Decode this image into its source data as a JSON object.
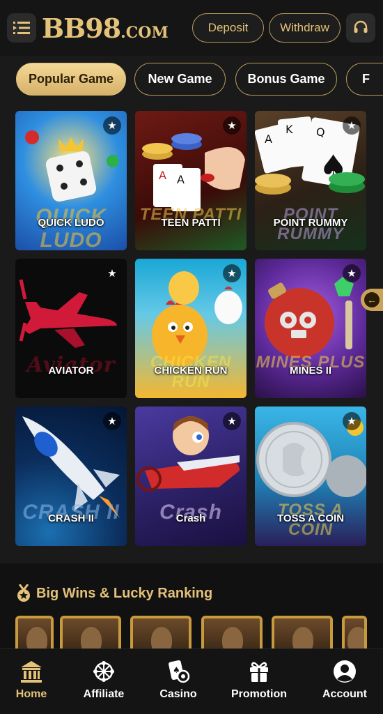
{
  "header": {
    "logo_main": "BB98",
    "logo_suffix": ".COM",
    "deposit_label": "Deposit",
    "withdraw_label": "Withdraw"
  },
  "tabs": [
    {
      "label": "Popular Game",
      "active": true
    },
    {
      "label": "New Game",
      "active": false
    },
    {
      "label": "Bonus Game",
      "active": false
    },
    {
      "label": "F",
      "active": false
    }
  ],
  "games": [
    {
      "label": "QUICK LUDO",
      "wordmark": "QUICK LUDO",
      "colors": [
        "#1c6fd6",
        "#f0a32a"
      ]
    },
    {
      "label": "TEEN PATTI",
      "wordmark": "TEEN PATTI",
      "colors": [
        "#5a1410",
        "#2e6b2a"
      ]
    },
    {
      "label": "POINT RUMMY",
      "wordmark": "POINT RUMMY",
      "colors": [
        "#4a3520",
        "#1e5a2c"
      ]
    },
    {
      "label": "AVIATOR",
      "wordmark": "Aviator",
      "colors": [
        "#0d0d0d",
        "#3a0a0a"
      ]
    },
    {
      "label": "CHICKEN RUN",
      "wordmark": "CHICKEN RUN",
      "colors": [
        "#1aa3c9",
        "#f5b22a"
      ]
    },
    {
      "label": "MINES II",
      "wordmark": "MINES PLUS",
      "colors": [
        "#5a2a8a",
        "#c23a2a"
      ]
    },
    {
      "label": "CRASH II",
      "wordmark": "CRASH II",
      "colors": [
        "#0b2d5c",
        "#1b6fb0"
      ]
    },
    {
      "label": "Crash",
      "wordmark": "Crash",
      "colors": [
        "#3a2a7a",
        "#c93a2a"
      ]
    },
    {
      "label": "TOSS A COIN",
      "wordmark": "TOSS A COIN",
      "colors": [
        "#1f8fc0",
        "#3a2a6a"
      ]
    }
  ],
  "ranking": {
    "title": "Big Wins & Lucky Ranking"
  },
  "nav": [
    {
      "label": "Home",
      "icon": "bank-icon",
      "active": true
    },
    {
      "label": "Affiliate",
      "icon": "network-icon",
      "active": false
    },
    {
      "label": "Casino",
      "icon": "cards-chip-icon",
      "active": false
    },
    {
      "label": "Promotion",
      "icon": "gift-icon",
      "active": false
    },
    {
      "label": "Account",
      "icon": "user-icon",
      "active": false
    }
  ],
  "colors": {
    "gold": "#e5c27a",
    "background": "#1a1a1a"
  }
}
